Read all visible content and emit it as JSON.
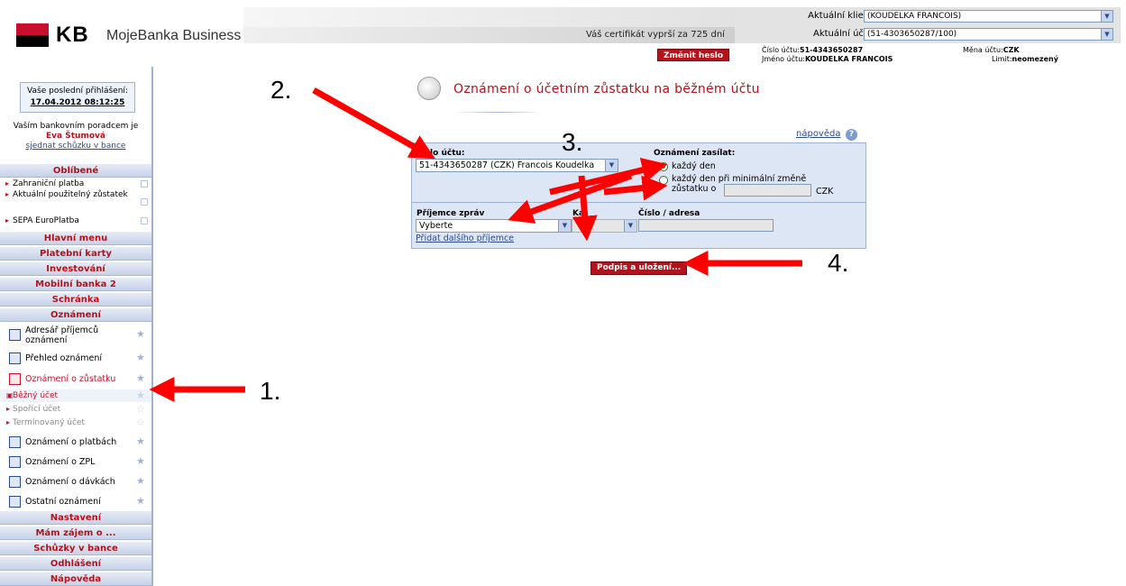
{
  "header": {
    "brand": "KB",
    "app_name": "MojeBanka Business",
    "certificate_notice": "Váš certifikát vyprší za 725 dní",
    "change_password": "Změnit heslo",
    "client_label": "Aktuální klient",
    "client_value": "(KOUDELKA FRANCOIS)",
    "account_label": "Aktuální účet",
    "account_value": "(51-4303650287/100)",
    "account_number_label": "Číslo účtu:",
    "account_number": "51-4343650287",
    "account_name_label": "Jméno účtu:",
    "account_name": "KOUDELKA FRANCOIS",
    "currency_label": "Měna účtu:",
    "currency": "CZK",
    "limit_label": "Limit:",
    "limit": "neomezený"
  },
  "sidebar": {
    "last_login_label": "Vaše poslední přihlášení:",
    "last_login_date": "17.04.2012 08:12:25",
    "advisor_label": "Vaším bankovním poradcem je",
    "advisor_name": "Eva Štumová",
    "advisor_link": "sjednat schůzku v bance",
    "favorites_title": "Oblíbené",
    "favorites": [
      {
        "label": "Zahraniční platba"
      },
      {
        "label": "Aktuální použitelný zůstatek"
      },
      {
        "label": "SEPA EuroPlatba"
      }
    ],
    "menu": [
      "Hlavní menu",
      "Platební karty",
      "Investování",
      "Mobilní banka 2",
      "Schránka",
      "Oznámení"
    ],
    "notifications": [
      {
        "label": "Adresář příjemců oznámení",
        "icon": "envelope-icon"
      },
      {
        "label": "Přehled oznámení",
        "icon": "list-icon"
      },
      {
        "label": "Oznámení o zůstatku",
        "icon": "balance-icon"
      }
    ],
    "balance_sub": [
      {
        "label": "Běžný účet"
      },
      {
        "label": "Spořící účet"
      },
      {
        "label": "Termínovaný účet"
      }
    ],
    "notifications2": [
      {
        "label": "Oznámení o platbách",
        "icon": "payments-icon"
      },
      {
        "label": "Oznámení o ZPL",
        "icon": "zpl-icon"
      },
      {
        "label": "Oznámení o dávkách",
        "icon": "batch-icon"
      },
      {
        "label": "Ostatní oznámení",
        "icon": "other-icon"
      }
    ],
    "menu2": [
      "Nastavení",
      "Mám zájem o ...",
      "Schůzky v bance",
      "Odhlášení",
      "Nápověda"
    ]
  },
  "main": {
    "title": "Oznámení o účetním zůstatku na běžném účtu",
    "help": "nápověda",
    "account_label": "Číslo účtu:",
    "account_value": "51-4343650287 (CZK) Francois Koudelka",
    "notify_label": "Oznámení zasílat:",
    "option_daily": "každý den",
    "option_min_change": "každý den při minimální změně zůstatku o",
    "currency": "CZK",
    "recipient_label": "Příjemce zpráv",
    "recipient_value": "Vyberte",
    "channel_label": "Ka",
    "address_label": "Číslo / adresa",
    "add_recipient": "Přidat dalšího příjemce",
    "submit": "Podpis a uložení..."
  },
  "annotations": [
    "1.",
    "2.",
    "3.",
    "4."
  ],
  "colors": {
    "brand_red": "#c8102e",
    "accent_blue": "#2b4a8c",
    "panel": "#dde6f5"
  }
}
